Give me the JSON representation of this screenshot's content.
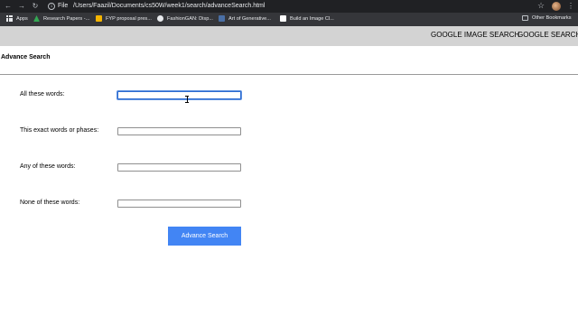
{
  "browser": {
    "file_label": "File",
    "url": "/Users/Faazil/Documents/cs50W/week1/search/advanceSearch.html",
    "bookmarks": [
      {
        "label": "Apps",
        "icon": "apps-grid-icon"
      },
      {
        "label": "Research Papers -...",
        "icon": "google-drive-icon",
        "color": "#34a853"
      },
      {
        "label": "FYP proposal pres...",
        "icon": "slides-icon",
        "color": "#f4b400"
      },
      {
        "label": "FashionGAN: Disp...",
        "icon": "github-icon",
        "color": "#e8eaed"
      },
      {
        "label": "Art of Generative...",
        "icon": "site-icon",
        "color": "#4a6fa5"
      },
      {
        "label": "Build an Image Cl...",
        "icon": "page-icon",
        "color": "#ffffff"
      }
    ],
    "other_bookmarks": "Other Bookmarks"
  },
  "nav": {
    "image_search": "GOOGLE IMAGE SEARCH",
    "search": "GOOGLE SEARCH"
  },
  "page": {
    "heading": "Advance Search"
  },
  "form": {
    "fields": [
      {
        "label": "All these words:",
        "value": ""
      },
      {
        "label": "This exact words or phases:",
        "value": ""
      },
      {
        "label": "Any of these words:",
        "value": ""
      },
      {
        "label": "None of these words:",
        "value": ""
      }
    ],
    "submit": "Advance Search"
  },
  "colors": {
    "nav_bar": "#d3d3d3",
    "button": "#4285f4",
    "focus": "#2d6cd0"
  }
}
